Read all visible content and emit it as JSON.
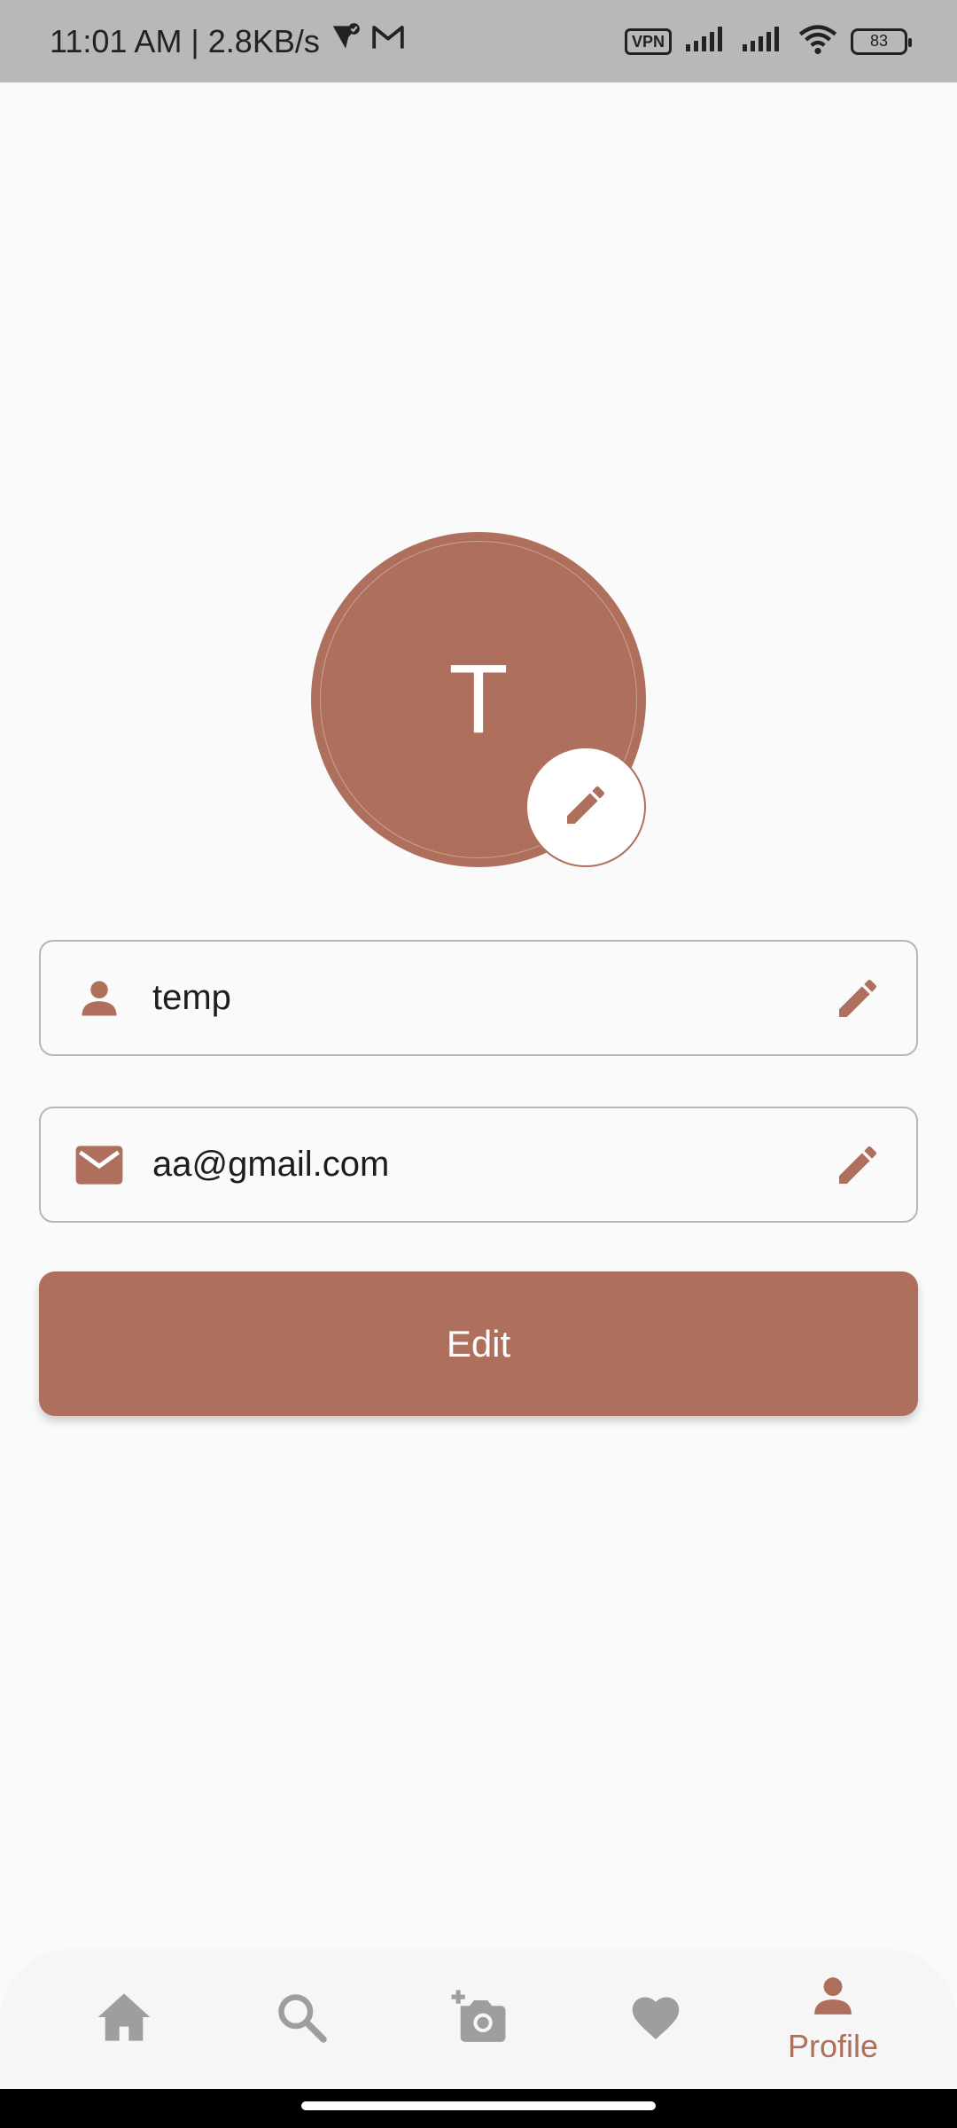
{
  "status_bar": {
    "time_speed": "11:01 AM | 2.8KB/s",
    "vpn": "VPN",
    "battery": "83"
  },
  "profile": {
    "avatar_letter": "T",
    "name_value": "temp",
    "email_value": "aa@gmail.com",
    "edit_button_label": "Edit"
  },
  "bottom_nav": {
    "items": [
      {
        "icon": "home-icon",
        "label": ""
      },
      {
        "icon": "search-icon",
        "label": ""
      },
      {
        "icon": "add-photo-icon",
        "label": ""
      },
      {
        "icon": "heart-icon",
        "label": ""
      },
      {
        "icon": "person-icon",
        "label": "Profile"
      }
    ],
    "active_index": 4
  },
  "colors": {
    "accent": "#AE705C",
    "inactive_icon": "#9E9E9E",
    "background": "#FAFAFA",
    "status_bar": "#B8B8B8"
  }
}
